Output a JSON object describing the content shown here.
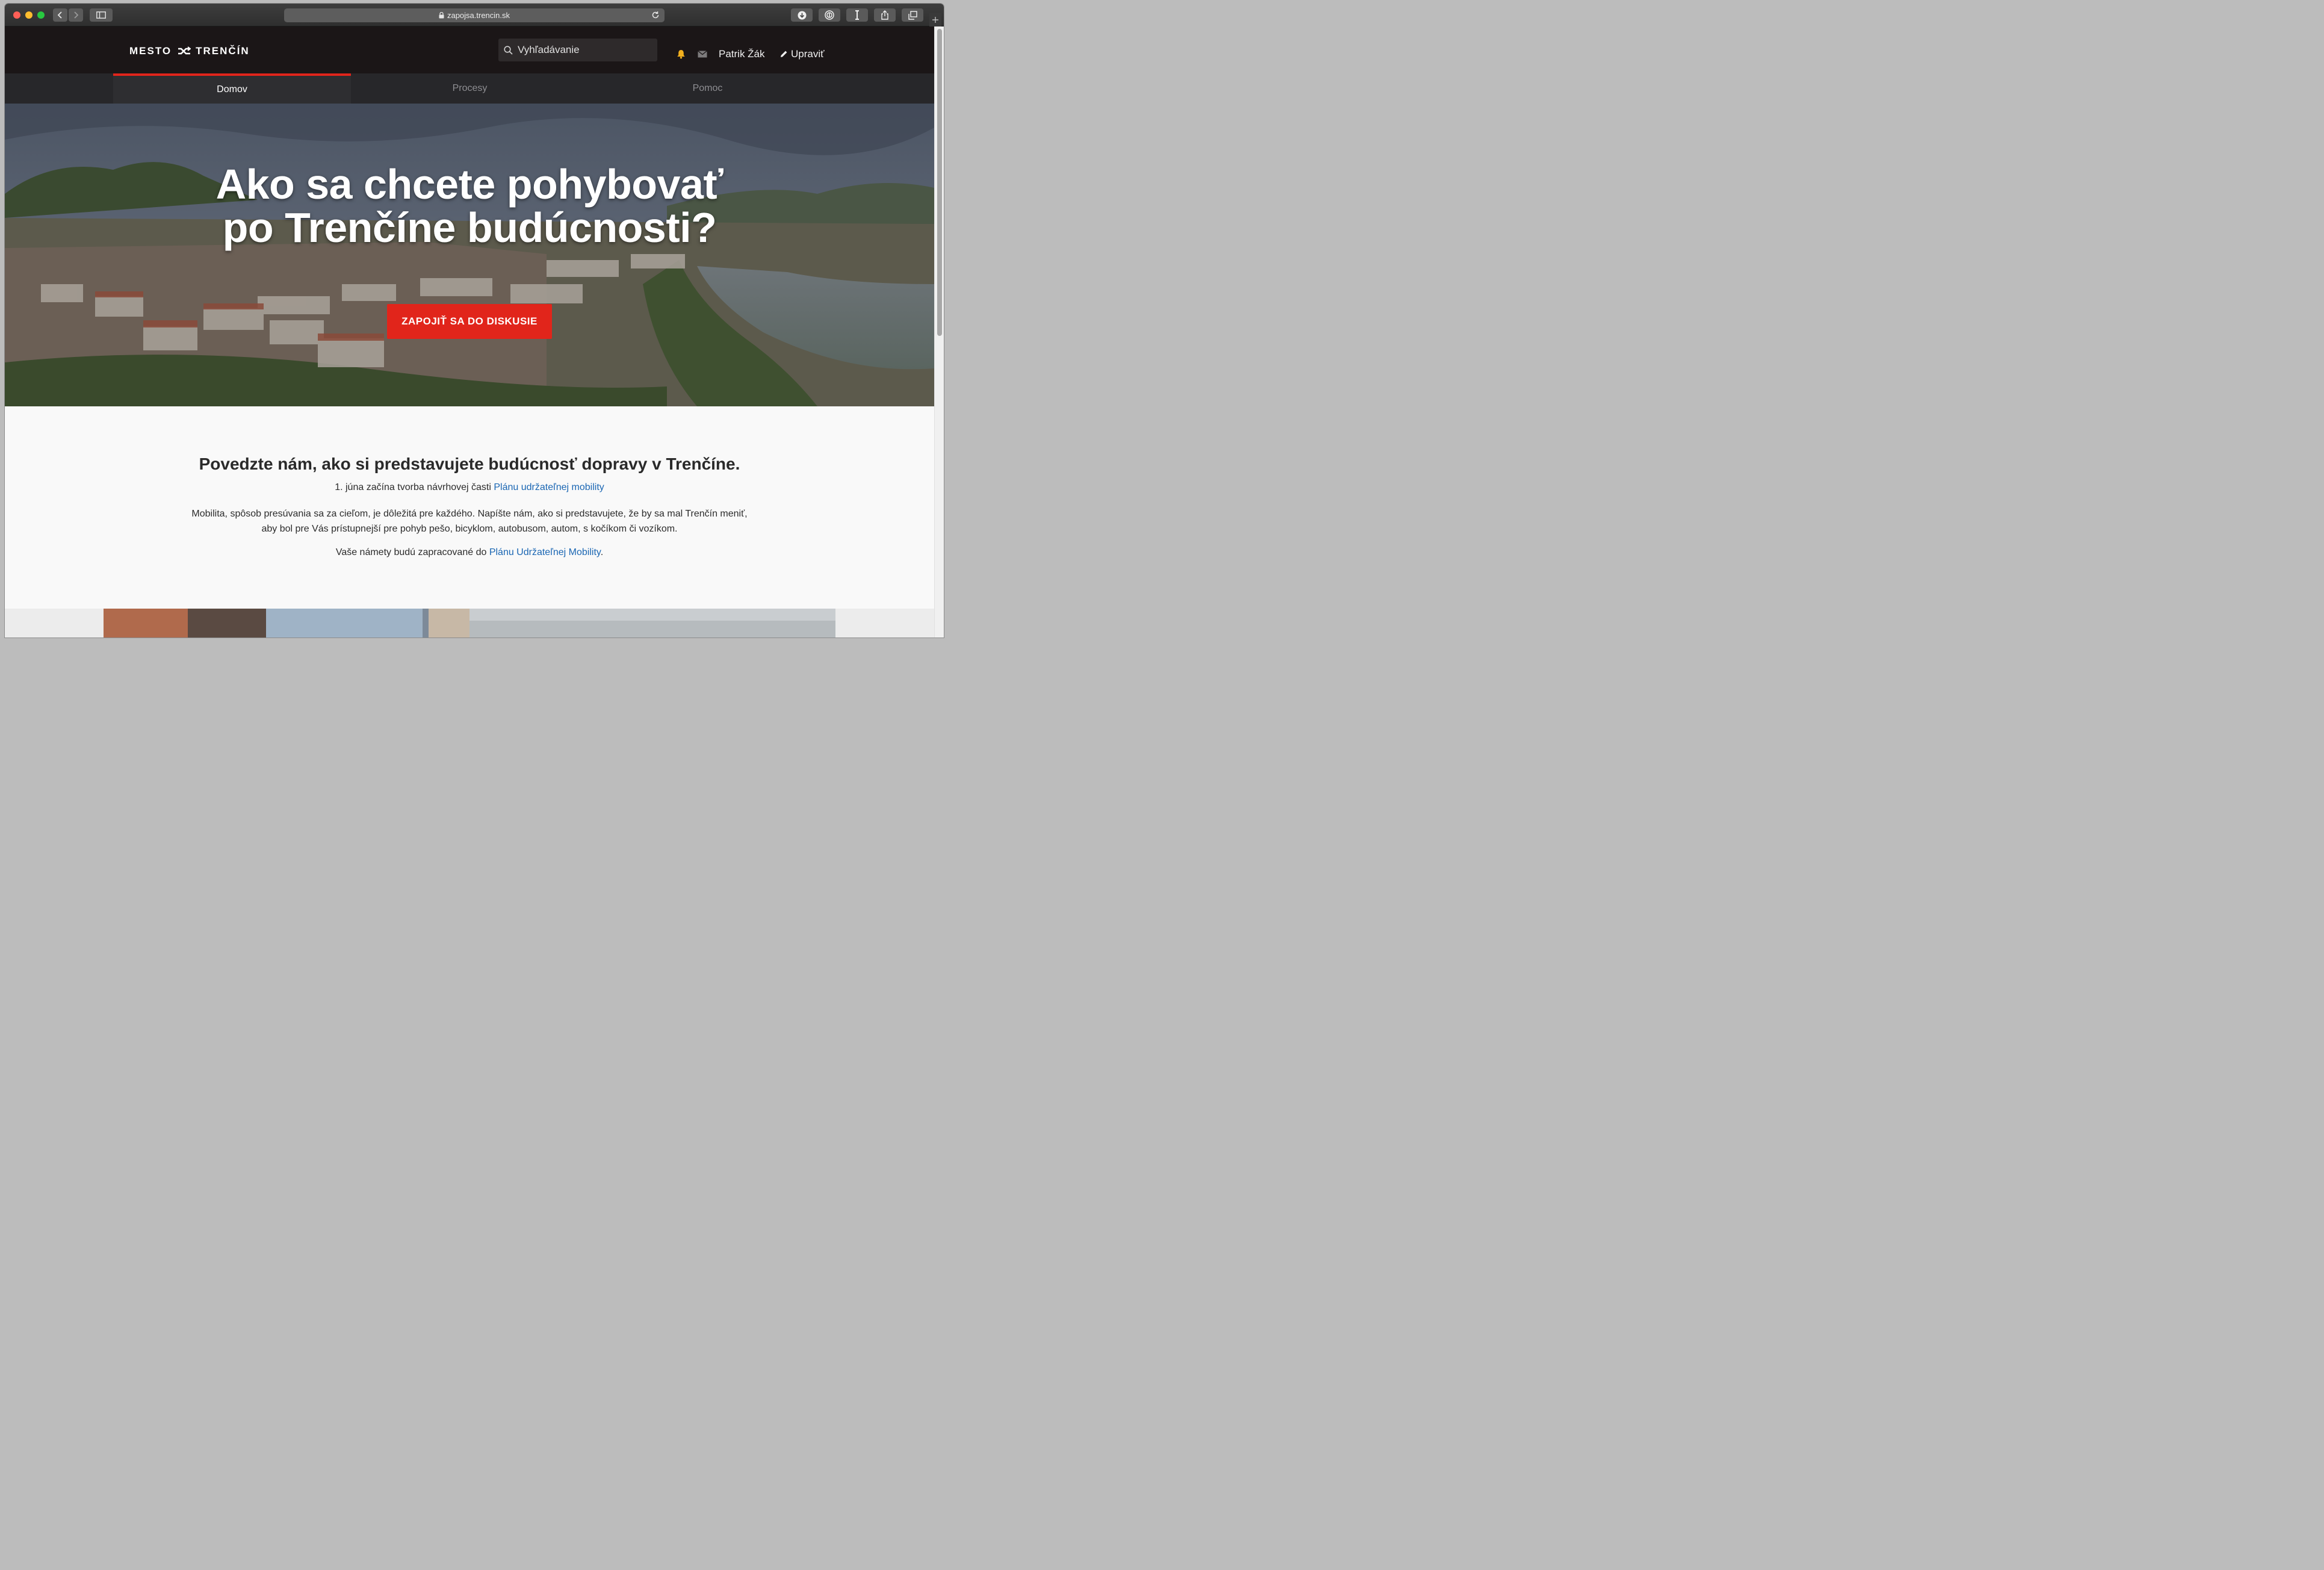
{
  "browser": {
    "url": "zapojsa.trencin.sk"
  },
  "header": {
    "logo_left": "MESTO",
    "logo_right": "TRENČÍN",
    "search_placeholder": "Vyhľadávanie",
    "user_name": "Patrik Žák",
    "edit_label": "Upraviť"
  },
  "tabs": [
    {
      "label": "Domov",
      "active": true
    },
    {
      "label": "Procesy",
      "active": false
    },
    {
      "label": "Pomoc",
      "active": false
    }
  ],
  "hero": {
    "title_line1": "Ako sa chcete pohybovať",
    "title_line2": "po Trenčíne budúcnosti?",
    "cta_label": "ZAPOJIŤ SA DO DISKUSIE"
  },
  "content": {
    "heading": "Povedzte nám, ako si predstavujete budúcnosť dopravy v Trenčíne.",
    "line1_text": "1. júna začína tvorba návrhovej časti ",
    "line1_link": "Plánu udržateľnej mobility",
    "paragraph": "Mobilita, spôsob presúvania sa za cieľom, je dôležitá pre každého. Napíšte nám, ako si predstavujete, že by sa mal Trenčín meniť, aby bol pre Vás prístupnejší pre pohyb pešo, bicyklom, autobusom, autom, s kočíkom či vozíkom.",
    "line3_text": "Vaše námety budú zapracované do ",
    "line3_link": "Plánu Udržateľnej Mobility",
    "line3_end": "."
  },
  "colors": {
    "accent": "#e1251b",
    "header_bg": "#1b1617",
    "link": "#1a66b3",
    "bell": "#f2b01e"
  }
}
